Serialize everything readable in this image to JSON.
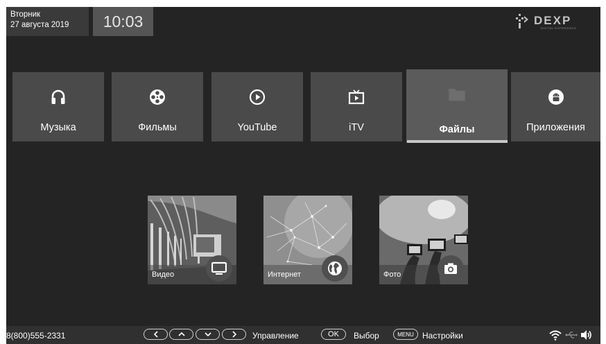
{
  "header": {
    "weekday": "Вторник",
    "date": "27 августа 2019",
    "time": "10:03",
    "logo_text": "DEXP",
    "logo_tagline": "DIGITAL EXPERIENCE"
  },
  "menu": {
    "selected_index": 4,
    "items": [
      {
        "label": "Музыка",
        "icon": "headphones-icon"
      },
      {
        "label": "Фильмы",
        "icon": "film-reel-icon"
      },
      {
        "label": "YouTube",
        "icon": "play-circle-icon"
      },
      {
        "label": "iTV",
        "icon": "tv-icon"
      },
      {
        "label": "Файлы",
        "icon": "folder-icon"
      },
      {
        "label": "Приложения",
        "icon": "android-icon"
      }
    ]
  },
  "cards": [
    {
      "label": "Видео",
      "icon": "monitor-icon"
    },
    {
      "label": "Интернет",
      "icon": "globe-icon"
    },
    {
      "label": "Фото",
      "icon": "camera-icon"
    }
  ],
  "bottom_bar": {
    "phone": "8(800)555-2331",
    "nav_label": "Управление",
    "ok_key": "OK",
    "ok_label": "Выбор",
    "menu_key": "MENU",
    "menu_label": "Настройки",
    "status_icons": [
      "wifi-icon",
      "usb-icon",
      "volume-icon"
    ]
  },
  "colors": {
    "background": "#242424",
    "tile": "#4a4a4a",
    "tile_selected": "#5b5b5b",
    "text": "#ffffff"
  }
}
